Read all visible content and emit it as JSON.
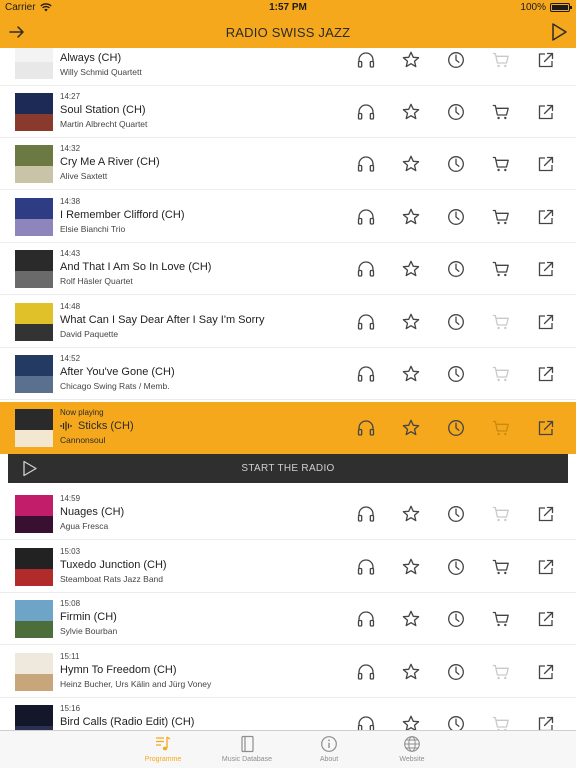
{
  "statusbar": {
    "carrier": "Carrier",
    "time": "1:57 PM",
    "battery": "100%"
  },
  "navbar": {
    "title": "RADIO SWISS JAZZ"
  },
  "colors": {
    "accent": "#f6a81c",
    "radio_bar": "#2f2f2f",
    "icon_dark": "#444444",
    "icon_disabled": "#c9c9c9"
  },
  "programme": [
    {
      "time": "",
      "title": "Always (CH)",
      "artist": "Willy Schmid Quartett",
      "playing": false,
      "cart": false,
      "cover": [
        "#f3f3f3",
        "#e8e8e8"
      ]
    },
    {
      "time": "14:27",
      "title": "Soul Station (CH)",
      "artist": "Martin Albrecht Quartet",
      "playing": false,
      "cart": true,
      "cover": [
        "#1c2a55",
        "#8a3a2c"
      ]
    },
    {
      "time": "14:32",
      "title": "Cry Me A River (CH)",
      "artist": "Alive Saxtett",
      "playing": false,
      "cart": true,
      "cover": [
        "#6b7a43",
        "#c9c3a7"
      ]
    },
    {
      "time": "14:38",
      "title": "I Remember Clifford (CH)",
      "artist": "Elsie Bianchi Trio",
      "playing": false,
      "cart": true,
      "cover": [
        "#2d3c83",
        "#8e85bd"
      ]
    },
    {
      "time": "14:43",
      "title": "And That I Am So In Love (CH)",
      "artist": "Rolf Häsler Quartet",
      "playing": false,
      "cart": true,
      "cover": [
        "#2a2a2a",
        "#6a6a6a"
      ]
    },
    {
      "time": "14:48",
      "title": "What Can I Say Dear After I Say I'm Sorry",
      "artist": "David Paquette",
      "playing": false,
      "cart": false,
      "cover": [
        "#e0c12a",
        "#333333"
      ]
    },
    {
      "time": "14:52",
      "title": "After You've Gone (CH)",
      "artist": "Chicago Swing Rats / Memb.",
      "playing": false,
      "cart": false,
      "cover": [
        "#233a63",
        "#5b6f8f"
      ]
    },
    {
      "time": "Now playing",
      "title": "Sticks (CH)",
      "artist": "Cannonsoul",
      "playing": true,
      "cart": false,
      "cover": [
        "#2a2a2a",
        "#f3e7cf"
      ]
    },
    {
      "time": "14:59",
      "title": "Nuages (CH)",
      "artist": "Agua Fresca",
      "playing": false,
      "cart": false,
      "cover": [
        "#c21d6b",
        "#3a1030"
      ]
    },
    {
      "time": "15:03",
      "title": "Tuxedo Junction (CH)",
      "artist": "Steamboat Rats Jazz Band",
      "playing": false,
      "cart": true,
      "cover": [
        "#222222",
        "#b22b2b"
      ]
    },
    {
      "time": "15:08",
      "title": "Firmin (CH)",
      "artist": "Sylvie Bourban",
      "playing": false,
      "cart": true,
      "cover": [
        "#6ea4c8",
        "#4c6e3a"
      ]
    },
    {
      "time": "15:11",
      "title": "Hymn To Freedom (CH)",
      "artist": "Heinz Bucher, Urs Kälin and Jürg Voney",
      "playing": false,
      "cart": false,
      "cover": [
        "#efe8dc",
        "#c8a67c"
      ]
    },
    {
      "time": "15:16",
      "title": "Bird Calls (Radio Edit) (CH)",
      "artist": "",
      "playing": false,
      "cart": false,
      "cover": [
        "#14162a",
        "#2a3052"
      ]
    }
  ],
  "radio_bar": {
    "label": "START THE RADIO"
  },
  "tabs": [
    {
      "label": "Programme",
      "icon": "music-note-list-icon",
      "active": true
    },
    {
      "label": "Music Database",
      "icon": "book-icon",
      "active": false
    },
    {
      "label": "About",
      "icon": "info-icon",
      "active": false
    },
    {
      "label": "Website",
      "icon": "globe-icon",
      "active": false
    }
  ]
}
